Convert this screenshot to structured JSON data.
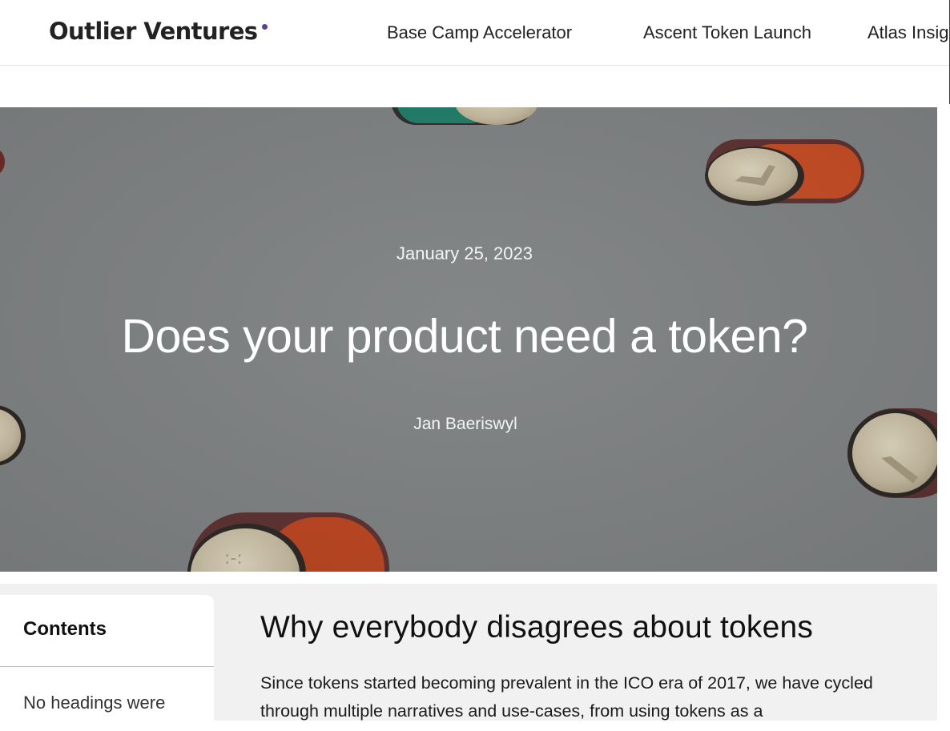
{
  "header": {
    "logo_text": "Outlier Ventures",
    "nav": [
      {
        "label": "Base Camp Accelerator"
      },
      {
        "label": "Ascent Token Launch"
      },
      {
        "label": "Atlas Insig"
      }
    ]
  },
  "hero": {
    "date": "January 25, 2023",
    "title": "Does your product need a token?",
    "author": "Jan Baeriswyl"
  },
  "toc": {
    "title": "Contents",
    "empty_message": "No headings were"
  },
  "article": {
    "heading": "Why everybody disagrees about tokens",
    "paragraph": "Since tokens started becoming prevalent in the ICO era of 2017, we have cycled through multiple narratives and use-cases, from using tokens as a"
  },
  "colors": {
    "brand_accent": "#5a3e98",
    "hero_background": "#7c7f80",
    "content_background": "#f1f1f1"
  }
}
